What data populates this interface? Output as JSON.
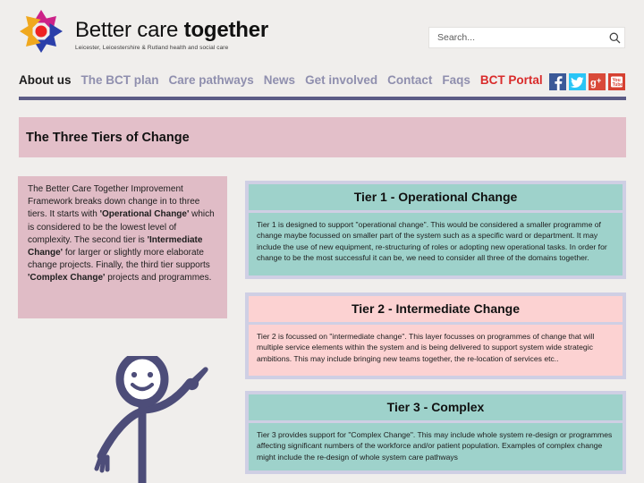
{
  "header": {
    "brand_name_light": "Better care ",
    "brand_name_bold": "together",
    "tagline": "Leicester, Leicestershire & Rutland health and social care",
    "logo_icon": "flower-petal-logo",
    "search": {
      "placeholder": "Search...",
      "value": "",
      "icon": "search-icon"
    },
    "social": [
      {
        "name": "facebook-icon",
        "label": "f"
      },
      {
        "name": "twitter-icon",
        "label": "t"
      },
      {
        "name": "google-plus-icon",
        "label": "g+"
      },
      {
        "name": "youtube-icon",
        "label": "You Tube"
      }
    ]
  },
  "nav": {
    "items": [
      {
        "label": "About us",
        "state": "active"
      },
      {
        "label": "The BCT plan",
        "state": "default"
      },
      {
        "label": "Care pathways",
        "state": "default"
      },
      {
        "label": "News",
        "state": "default"
      },
      {
        "label": "Get involved",
        "state": "default"
      },
      {
        "label": "Contact",
        "state": "default"
      },
      {
        "label": "Faqs",
        "state": "default"
      },
      {
        "label": "BCT Portal",
        "state": "portal"
      }
    ]
  },
  "page": {
    "title": "The Three Tiers of Change"
  },
  "intro": {
    "paragraph_html": "The Better Care Together Improvement Framework breaks down change in to three tiers. It starts with <b>'Operational Change'</b> which is considered to be the lowest level of complexity. The second tier is <b>'Intermediate Change'</b> for larger or slightly more elaborate change projects. Finally, the third tier supports <b>'Complex Change'</b> projects and programmes."
  },
  "illustration": {
    "name": "stick-figure-pointing",
    "color": "#4d4d79"
  },
  "tiers": [
    {
      "id": "tier-1",
      "header": "Tier 1 - Operational Change",
      "body": "Tier 1 is designed to support \"operational change\". This would be considered a smaller programme of change maybe focussed on smaller part of the system such as a specific ward or department. It may include the use of new equipment, re-structuring of roles or adopting new operational tasks. In order for change to be the most successful it can be, we need to consider all three of the domains together.",
      "accent": "#9ed2cb"
    },
    {
      "id": "tier-2",
      "header": "Tier 2 - Intermediate Change",
      "body": "Tier 2 is focussed on \"intermediate change\". This layer focusses on programmes of change that will multiple service elements within the system and is being delivered to support system wide strategic ambitions. This may include bringing new teams together, the re-location of services etc..",
      "accent": "#fcd2d2"
    },
    {
      "id": "tier-3",
      "header": "Tier 3 - Complex",
      "body": "Tier 3 provides support for \"Complex Change\". This may include whole system re-design or programmes affecting significant numbers of the workforce and/or patient population. Examples of complex change might include the re-design of whole system care pathways",
      "accent": "#9ed2cb"
    }
  ],
  "colors": {
    "page_background": "#f0eeec",
    "nav_rule": "#5b5b85",
    "banner_pink": "#e3bfc9",
    "panel_frame": "#cfcfe4",
    "portal_red": "#d92b2b"
  }
}
